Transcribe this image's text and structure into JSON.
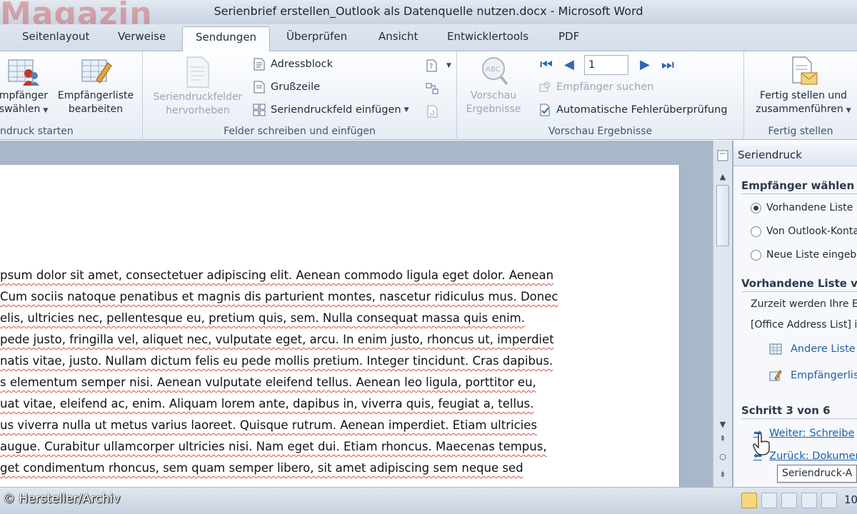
{
  "window": {
    "brand_watermark": "Magazin",
    "title": "Serienbrief erstellen_Outlook als Datenquelle nutzen.docx - Microsoft Word"
  },
  "tabs": [
    "Seitenlayout",
    "Verweise",
    "Sendungen",
    "Überprüfen",
    "Ansicht",
    "Entwicklertools",
    "PDF"
  ],
  "active_tab": "Sendungen",
  "ribbon": {
    "group_start": {
      "label": "ndruck starten",
      "btn_recipients_1": "mpfänger",
      "btn_recipients_2": "swählen",
      "btn_edit_list_1": "Empfängerliste",
      "btn_edit_list_2": "bearbeiten"
    },
    "group_fields": {
      "label": "Felder schreiben und einfügen",
      "btn_highlight_1": "Seriendruckfelder",
      "btn_highlight_2": "hervorheben",
      "btn_address": "Adressblock",
      "btn_greeting": "Grußzeile",
      "btn_insert_field": "Seriendruckfeld einfügen"
    },
    "group_preview": {
      "label": "Vorschau Ergebnisse",
      "btn_preview_1": "Vorschau",
      "btn_preview_2": "Ergebnisse",
      "record_number": "1",
      "btn_find": "Empfänger suchen",
      "btn_autocheck": "Automatische Fehlerüberprüfung"
    },
    "group_finish": {
      "label": "Fertig stellen",
      "btn_finish_1": "Fertig stellen und",
      "btn_finish_2": "zusammenführen"
    }
  },
  "document": {
    "lines": [
      "psum dolor sit amet, consectetuer adipiscing elit. Aenean commodo ligula eget dolor. Aenean",
      "Cum sociis natoque penatibus et magnis dis parturient montes, nascetur ridiculus mus. Donec",
      "elis, ultricies nec, pellentesque eu, pretium quis, sem. Nulla consequat massa quis enim.",
      "pede justo, fringilla vel, aliquet nec, vulputate eget, arcu. In enim justo, rhoncus ut, imperdiet",
      "natis vitae, justo. Nullam dictum felis eu pede mollis pretium. Integer tincidunt. Cras dapibus.",
      "s elementum semper nisi. Aenean vulputate eleifend tellus. Aenean leo ligula, porttitor eu,",
      "uat vitae, eleifend ac, enim. Aliquam lorem ante, dapibus in, viverra quis, feugiat a, tellus.",
      "us viverra nulla ut metus varius laoreet. Quisque rutrum. Aenean imperdiet. Etiam ultricies",
      "augue. Curabitur ullamcorper ultricies nisi. Nam eget dui. Etiam rhoncus. Maecenas tempus,",
      "get condimentum rhoncus, sem quam semper libero, sit amet adipiscing sem neque sed"
    ]
  },
  "task_pane": {
    "title": "Seriendruck",
    "section_choose": "Empfänger wählen",
    "option_existing": "Vorhandene Liste",
    "option_outlook": "Von Outlook-Konta",
    "option_new": "Neue Liste eingebe",
    "section_use": "Vorhandene Liste ve",
    "info_line_1": "Zurzeit werden Ihre E",
    "info_line_2": "[Office Address List] i",
    "link_other": "Andere Liste",
    "link_edit": "Empfängerlist",
    "step": "Schritt 3 von 6",
    "link_next": "Weiter: Schreibe",
    "link_back": "Zurück: Dokumen",
    "tooltip": "Seriendruck-A"
  },
  "statusbar": {
    "credit": "© Hersteller/Archiv",
    "zoom": "10"
  },
  "colors": {
    "accent": "#1f5fa8",
    "ribbon_bg": "#e6ecf4",
    "spell_underline": "#e04a4a"
  }
}
